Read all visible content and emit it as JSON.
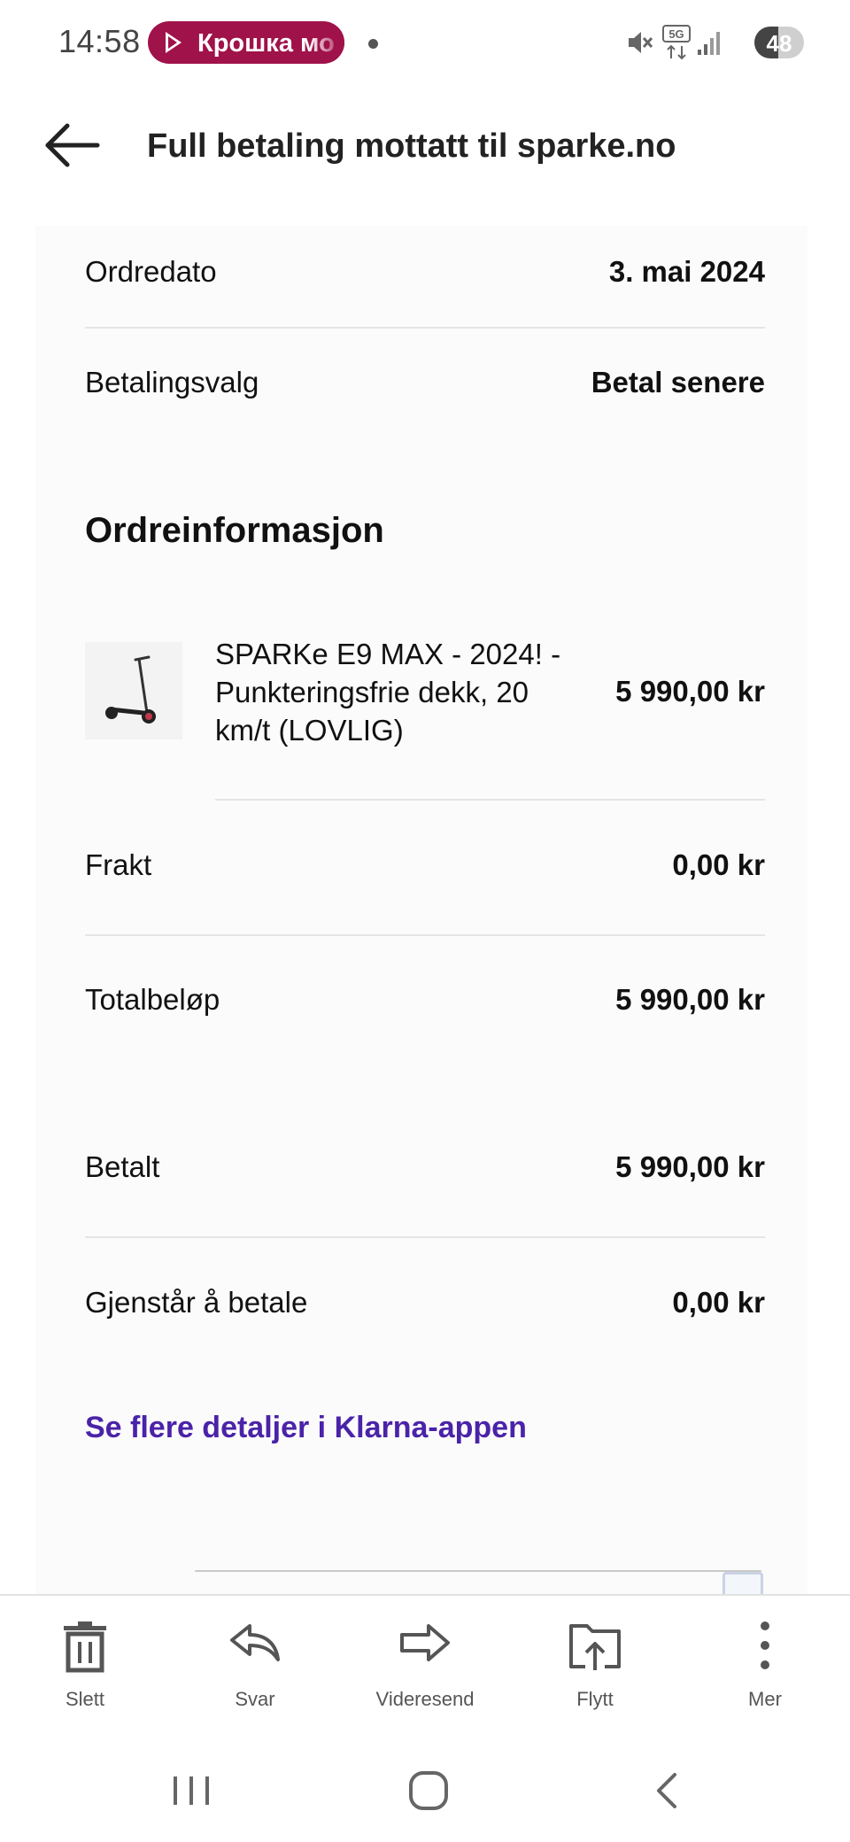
{
  "status_bar": {
    "time": "14:58",
    "media_pill_text": "Крошка мо",
    "network_label": "5G",
    "battery_level": "48",
    "battery_fraction": 0.48
  },
  "header": {
    "title": "Full betaling mottatt til sparke.no"
  },
  "order": {
    "date_label": "Ordredato",
    "date_value": "3. mai 2024",
    "payment_label": "Betalingsvalg",
    "payment_value": "Betal senere"
  },
  "order_info": {
    "heading": "Ordreinformasjon",
    "product_name": "SPARKe E9 MAX - 2024! - Punkteringsfrie dekk, 20 km/t (LOVLIG)",
    "product_price": "5 990,00 kr"
  },
  "summary": {
    "shipping_label": "Frakt",
    "shipping_value": "0,00 kr",
    "total_label": "Totalbeløp",
    "total_value": "5 990,00 kr",
    "paid_label": "Betalt",
    "paid_value": "5 990,00 kr",
    "remaining_label": "Gjenstår å betale",
    "remaining_value": "0,00 kr"
  },
  "klarna_link": "Se flere detaljer i Klarna-appen",
  "toolbar": {
    "delete_label": "Slett",
    "reply_label": "Svar",
    "forward_label": "Videresend",
    "move_label": "Flytt",
    "more_label": "Mer"
  },
  "colors": {
    "media_pill": "#a0124a",
    "link": "#4a23a8",
    "card_background": "#fcfbfc"
  },
  "icons": {
    "back": "arrow-left-icon",
    "delete": "trash-icon",
    "reply": "reply-icon",
    "forward": "forward-arrow-icon",
    "move": "move-to-folder-icon",
    "more": "vertical-dots-icon",
    "nav_recents": "recents-icon",
    "nav_home": "home-icon",
    "nav_back": "nav-back-icon"
  }
}
